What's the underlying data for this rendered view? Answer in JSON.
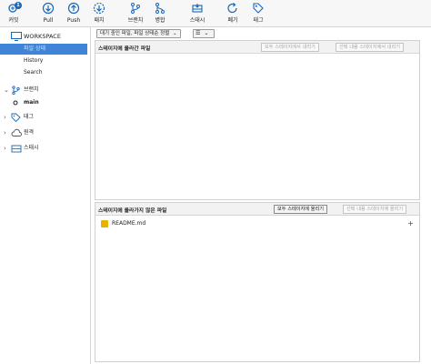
{
  "toolbar": {
    "commit": {
      "label": "커밋",
      "badge": "1"
    },
    "pull": {
      "label": "Pull"
    },
    "push": {
      "label": "Push"
    },
    "fetch": {
      "label": "패치"
    },
    "branch": {
      "label": "브랜치"
    },
    "merge": {
      "label": "병합"
    },
    "stash": {
      "label": "스태시"
    },
    "discard": {
      "label": "폐기"
    },
    "tag": {
      "label": "태그"
    }
  },
  "sidebar": {
    "workspace": {
      "label": "WORKSPACE"
    },
    "workspace_items": [
      "파일 상태",
      "History",
      "Search"
    ],
    "branches": {
      "label": "브랜치"
    },
    "branch_items": [
      "main"
    ],
    "tags": {
      "label": "태그"
    },
    "remotes": {
      "label": "원격"
    },
    "stashes": {
      "label": "스태시"
    }
  },
  "filter": {
    "status_dropdown": "대기 중인 파일, 파일 상태순 정렬",
    "view_dropdown": "☰"
  },
  "staged": {
    "title": "스테이지에 올라간 파일",
    "unstage_all": "모두 스테이지에서 내리기",
    "unstage_selected": "선택 내용 스테이지에서 내리기"
  },
  "unstaged": {
    "title": "스테이지에 올라가지 않은 파일",
    "stage_all": "모두 스테이지에 올리기",
    "stage_selected": "선택 내용 스테이지에 올리기",
    "files": [
      {
        "name": "README.md"
      }
    ]
  },
  "colors": {
    "selected_bg": "#3f84d6",
    "accent": "#1a66b8",
    "modified_file": "#e8b100"
  }
}
